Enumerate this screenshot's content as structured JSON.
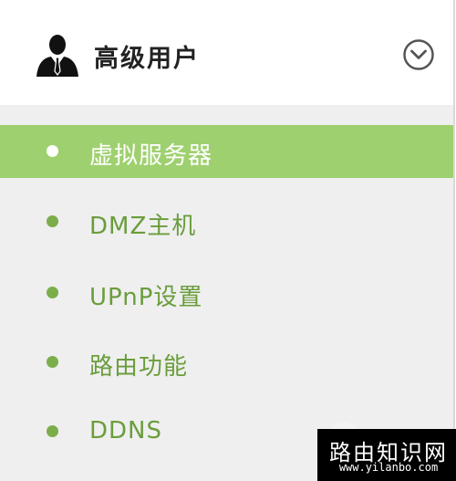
{
  "header": {
    "title": "高级用户",
    "user_icon": "user-icon",
    "toggle_icon": "chevron-down-circle-icon"
  },
  "menu": {
    "items": [
      {
        "label": "虚拟服务器",
        "active": true
      },
      {
        "label": "DMZ主机",
        "active": false
      },
      {
        "label": "UPnP设置",
        "active": false
      },
      {
        "label": "路由功能",
        "active": false
      },
      {
        "label": "DDNS",
        "active": false
      }
    ]
  },
  "watermark": {
    "title": "路由知识网",
    "url": "www.yilanbo.com"
  },
  "colors": {
    "accent": "#9fd06f",
    "text_green": "#6a9d3c",
    "menu_bg": "#efefef"
  }
}
